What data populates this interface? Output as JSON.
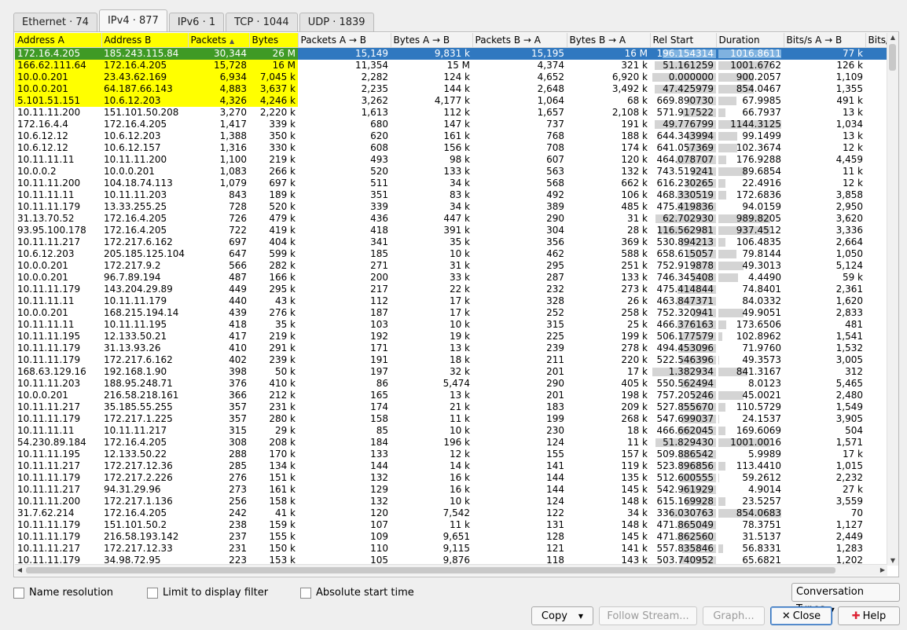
{
  "tabs": [
    {
      "label": "Ethernet · 74",
      "active": false
    },
    {
      "label": "IPv4 · 877",
      "active": true
    },
    {
      "label": "IPv6 · 1",
      "active": false
    },
    {
      "label": "TCP · 1044",
      "active": false
    },
    {
      "label": "UDP · 1839",
      "active": false
    }
  ],
  "columns": [
    "Address A",
    "Address B",
    "Packets",
    "Bytes",
    "Packets A → B",
    "Bytes A → B",
    "Packets B → A",
    "Bytes B → A",
    "Rel Start",
    "Duration",
    "Bits/s A → B",
    "Bits/"
  ],
  "sort_indicator": "▲",
  "rows": [
    [
      "172.16.4.205",
      "185.243.115.84",
      "30,344",
      "26 M",
      "15,149",
      "9,831 k",
      "15,195",
      "16 M",
      "196.154314",
      "1016.8611",
      "77 k"
    ],
    [
      "166.62.111.64",
      "172.16.4.205",
      "15,728",
      "16 M",
      "11,354",
      "15 M",
      "4,374",
      "321 k",
      "51.161259",
      "1001.6762",
      "126 k"
    ],
    [
      "10.0.0.201",
      "23.43.62.169",
      "6,934",
      "7,045 k",
      "2,282",
      "124 k",
      "4,652",
      "6,920 k",
      "0.000000",
      "900.2057",
      "1,109"
    ],
    [
      "10.0.0.201",
      "64.187.66.143",
      "4,883",
      "3,637 k",
      "2,235",
      "144 k",
      "2,648",
      "3,492 k",
      "47.425979",
      "854.0467",
      "1,355"
    ],
    [
      "5.101.51.151",
      "10.6.12.203",
      "4,326",
      "4,246 k",
      "3,262",
      "4,177 k",
      "1,064",
      "68 k",
      "669.890730",
      "67.9985",
      "491 k"
    ],
    [
      "10.11.11.200",
      "151.101.50.208",
      "3,270",
      "2,220 k",
      "1,613",
      "112 k",
      "1,657",
      "2,108 k",
      "571.917522",
      "66.7937",
      "13 k"
    ],
    [
      "172.16.4.4",
      "172.16.4.205",
      "1,417",
      "339 k",
      "680",
      "147 k",
      "737",
      "191 k",
      "49.776799",
      "1144.3125",
      "1,034"
    ],
    [
      "10.6.12.12",
      "10.6.12.203",
      "1,388",
      "350 k",
      "620",
      "161 k",
      "768",
      "188 k",
      "644.343994",
      "99.1499",
      "13 k"
    ],
    [
      "10.6.12.12",
      "10.6.12.157",
      "1,316",
      "330 k",
      "608",
      "156 k",
      "708",
      "174 k",
      "641.057369",
      "102.3674",
      "12 k"
    ],
    [
      "10.11.11.11",
      "10.11.11.200",
      "1,100",
      "219 k",
      "493",
      "98 k",
      "607",
      "120 k",
      "464.078707",
      "176.9288",
      "4,459"
    ],
    [
      "10.0.0.2",
      "10.0.0.201",
      "1,083",
      "266 k",
      "520",
      "133 k",
      "563",
      "132 k",
      "743.519241",
      "89.6854",
      "11 k"
    ],
    [
      "10.11.11.200",
      "104.18.74.113",
      "1,079",
      "697 k",
      "511",
      "34 k",
      "568",
      "662 k",
      "616.230265",
      "22.4916",
      "12 k"
    ],
    [
      "10.11.11.11",
      "10.11.11.203",
      "843",
      "189 k",
      "351",
      "83 k",
      "492",
      "106 k",
      "468.330519",
      "172.6836",
      "3,858"
    ],
    [
      "10.11.11.179",
      "13.33.255.25",
      "728",
      "520 k",
      "339",
      "34 k",
      "389",
      "485 k",
      "475.419836",
      "94.0159",
      "2,950"
    ],
    [
      "31.13.70.52",
      "172.16.4.205",
      "726",
      "479 k",
      "436",
      "447 k",
      "290",
      "31 k",
      "62.702930",
      "989.8205",
      "3,620"
    ],
    [
      "93.95.100.178",
      "172.16.4.205",
      "722",
      "419 k",
      "418",
      "391 k",
      "304",
      "28 k",
      "116.562981",
      "937.4512",
      "3,336"
    ],
    [
      "10.11.11.217",
      "172.217.6.162",
      "697",
      "404 k",
      "341",
      "35 k",
      "356",
      "369 k",
      "530.894213",
      "106.4835",
      "2,664"
    ],
    [
      "10.6.12.203",
      "205.185.125.104",
      "647",
      "599 k",
      "185",
      "10 k",
      "462",
      "588 k",
      "658.615057",
      "79.8144",
      "1,050"
    ],
    [
      "10.0.0.201",
      "172.217.9.2",
      "566",
      "282 k",
      "271",
      "31 k",
      "295",
      "251 k",
      "752.919878",
      "49.3013",
      "5,124"
    ],
    [
      "10.0.0.201",
      "96.7.89.194",
      "487",
      "166 k",
      "200",
      "33 k",
      "287",
      "133 k",
      "746.345408",
      "4.4490",
      "59 k"
    ],
    [
      "10.11.11.179",
      "143.204.29.89",
      "449",
      "295 k",
      "217",
      "22 k",
      "232",
      "273 k",
      "475.414844",
      "74.8401",
      "2,361"
    ],
    [
      "10.11.11.11",
      "10.11.11.179",
      "440",
      "43 k",
      "112",
      "17 k",
      "328",
      "26 k",
      "463.847371",
      "84.0332",
      "1,620"
    ],
    [
      "10.0.0.201",
      "168.215.194.14",
      "439",
      "276 k",
      "187",
      "17 k",
      "252",
      "258 k",
      "752.320941",
      "49.9051",
      "2,833"
    ],
    [
      "10.11.11.11",
      "10.11.11.195",
      "418",
      "35 k",
      "103",
      "10 k",
      "315",
      "25 k",
      "466.376163",
      "173.6506",
      "481"
    ],
    [
      "10.11.11.195",
      "12.133.50.21",
      "417",
      "219 k",
      "192",
      "19 k",
      "225",
      "199 k",
      "506.177579",
      "102.8962",
      "1,541"
    ],
    [
      "10.11.11.179",
      "31.13.93.26",
      "410",
      "291 k",
      "171",
      "13 k",
      "239",
      "278 k",
      "494.453096",
      "71.9760",
      "1,532"
    ],
    [
      "10.11.11.179",
      "172.217.6.162",
      "402",
      "239 k",
      "191",
      "18 k",
      "211",
      "220 k",
      "522.546396",
      "49.3573",
      "3,005"
    ],
    [
      "168.63.129.16",
      "192.168.1.90",
      "398",
      "50 k",
      "197",
      "32 k",
      "201",
      "17 k",
      "1.382934",
      "841.3167",
      "312"
    ],
    [
      "10.11.11.203",
      "188.95.248.71",
      "376",
      "410 k",
      "86",
      "5,474",
      "290",
      "405 k",
      "550.562494",
      "8.0123",
      "5,465"
    ],
    [
      "10.0.0.201",
      "216.58.218.161",
      "366",
      "212 k",
      "165",
      "13 k",
      "201",
      "198 k",
      "757.205246",
      "45.0021",
      "2,480"
    ],
    [
      "10.11.11.217",
      "35.185.55.255",
      "357",
      "231 k",
      "174",
      "21 k",
      "183",
      "209 k",
      "527.855670",
      "110.5729",
      "1,549"
    ],
    [
      "10.11.11.179",
      "172.217.1.225",
      "357",
      "280 k",
      "158",
      "11 k",
      "199",
      "268 k",
      "547.699037",
      "24.1537",
      "3,905"
    ],
    [
      "10.11.11.11",
      "10.11.11.217",
      "315",
      "29 k",
      "85",
      "10 k",
      "230",
      "18 k",
      "466.662045",
      "169.6069",
      "504"
    ],
    [
      "54.230.89.184",
      "172.16.4.205",
      "308",
      "208 k",
      "184",
      "196 k",
      "124",
      "11 k",
      "51.829430",
      "1001.0016",
      "1,571"
    ],
    [
      "10.11.11.195",
      "12.133.50.22",
      "288",
      "170 k",
      "133",
      "12 k",
      "155",
      "157 k",
      "509.886542",
      "5.9989",
      "17 k"
    ],
    [
      "10.11.11.217",
      "172.217.12.36",
      "285",
      "134 k",
      "144",
      "14 k",
      "141",
      "119 k",
      "523.896856",
      "113.4410",
      "1,015"
    ],
    [
      "10.11.11.179",
      "172.217.2.226",
      "276",
      "151 k",
      "132",
      "16 k",
      "144",
      "135 k",
      "512.600555",
      "59.2612",
      "2,232"
    ],
    [
      "10.11.11.217",
      "94.31.29.96",
      "273",
      "161 k",
      "129",
      "16 k",
      "144",
      "145 k",
      "542.961929",
      "4.9014",
      "27 k"
    ],
    [
      "10.11.11.200",
      "172.217.1.136",
      "256",
      "158 k",
      "132",
      "10 k",
      "124",
      "148 k",
      "615.169928",
      "23.5257",
      "3,559"
    ],
    [
      "31.7.62.214",
      "172.16.4.205",
      "242",
      "41 k",
      "120",
      "7,542",
      "122",
      "34 k",
      "336.030763",
      "854.0683",
      "70"
    ],
    [
      "10.11.11.179",
      "151.101.50.2",
      "238",
      "159 k",
      "107",
      "11 k",
      "131",
      "148 k",
      "471.865049",
      "78.3751",
      "1,127"
    ],
    [
      "10.11.11.179",
      "216.58.193.142",
      "237",
      "155 k",
      "109",
      "9,651",
      "128",
      "145 k",
      "471.862560",
      "31.5137",
      "2,449"
    ],
    [
      "10.11.11.217",
      "172.217.12.33",
      "231",
      "150 k",
      "110",
      "9,115",
      "121",
      "141 k",
      "557.835846",
      "56.8331",
      "1,283"
    ],
    [
      "10.11.11.179",
      "34.98.72.95",
      "223",
      "153 k",
      "105",
      "9,876",
      "118",
      "143 k",
      "503.740952",
      "65.6821",
      "1,202"
    ]
  ],
  "options": {
    "name_resolution": "Name resolution",
    "limit_filter": "Limit to display filter",
    "absolute_time": "Absolute start time",
    "conv_types": "Conversation Types"
  },
  "buttons": {
    "copy": "Copy",
    "follow": "Follow Stream...",
    "graph": "Graph...",
    "close": "Close",
    "help": "Help"
  },
  "colors": {
    "selection": "#3078c0",
    "highlight": "#ffff00",
    "highlight_selected": "#3f9a25"
  }
}
